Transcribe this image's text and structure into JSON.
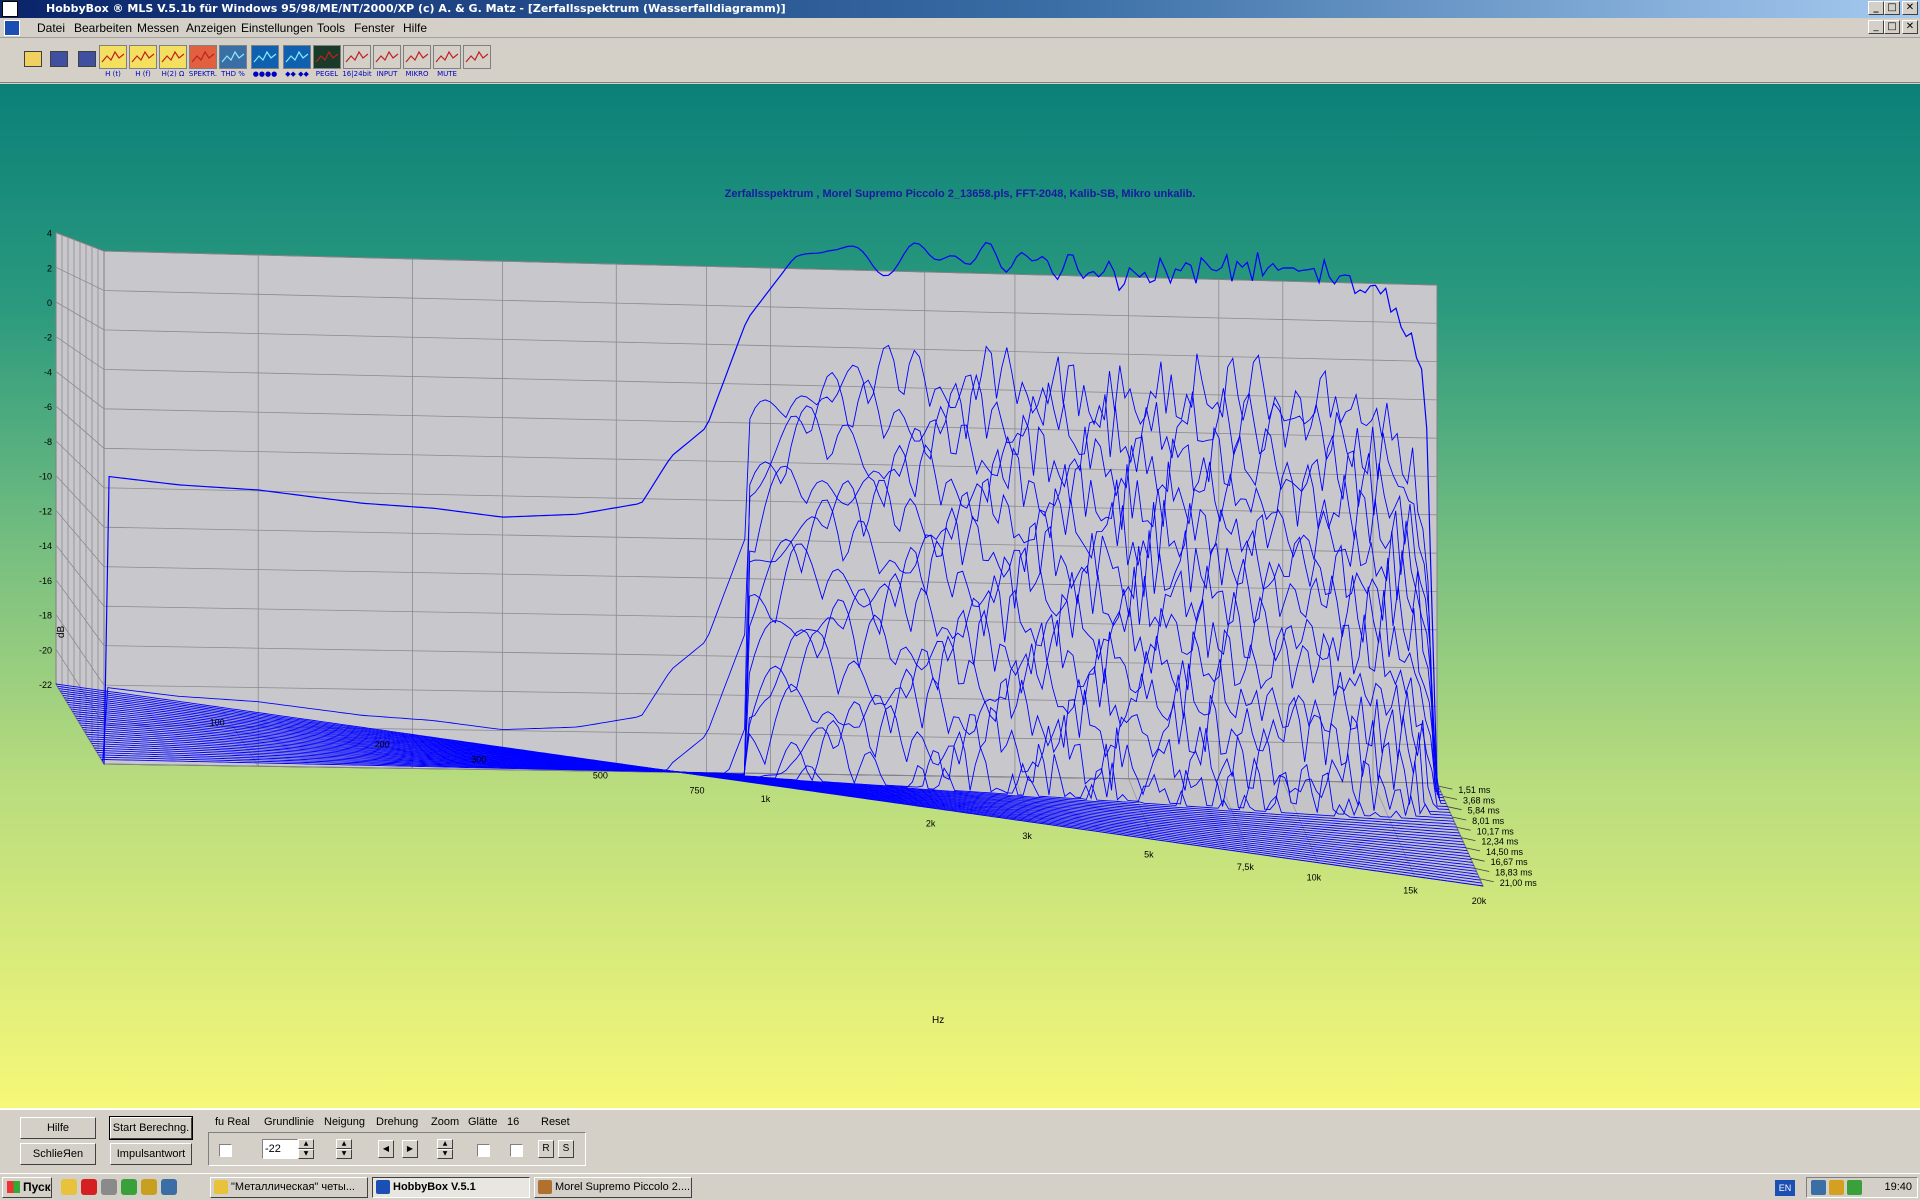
{
  "window": {
    "title": "HobbyBox ® MLS  V.5.1b   für Windows 95/98/ME/NT/2000/XP      (c)  A. & G. Matz - [Zerfallsspektrum  (Wasserfalldiagramm)]",
    "min": "_",
    "max": "□",
    "close": "✕"
  },
  "menu": [
    "Datei",
    "Bearbeiten",
    "Messen",
    "Anzeigen",
    "Einstellungen",
    "Tools",
    "Fenster",
    "Hilfe"
  ],
  "toolbar": [
    {
      "name": "open-icon",
      "label": ""
    },
    {
      "name": "save-icon",
      "label": ""
    },
    {
      "name": "print-icon",
      "label": ""
    },
    {
      "name": "impulse-response-icon",
      "label": "H (t)"
    },
    {
      "name": "frequency-response-icon",
      "label": "H (f)"
    },
    {
      "name": "impedance-icon",
      "label": "H(2) Ω"
    },
    {
      "name": "spectrum-icon",
      "label": "SPEKTR."
    },
    {
      "name": "thd-icon",
      "label": "THD %"
    },
    {
      "name": "meter-icon",
      "label": "●●●●"
    },
    {
      "name": "bargraph-icon",
      "label": "◆◆ ◆◆"
    },
    {
      "name": "level-icon",
      "label": "PEGEL"
    },
    {
      "name": "bit-icon",
      "label": "16|24bit"
    },
    {
      "name": "input-icon",
      "label": "INPUT"
    },
    {
      "name": "microphone-icon",
      "label": "MIKRO"
    },
    {
      "name": "mute-icon",
      "label": "MUTE"
    },
    {
      "name": "exit-icon",
      "label": ""
    }
  ],
  "chart_data": {
    "type": "waterfall",
    "title": "Zerfallsspektrum , Morel Supremo Piccolo 2_13658.pls, FFT-2048, Kalib-SB, Mikro unkalib.",
    "ylabel": "dB",
    "xlabel": "Hz",
    "y_ticks": [
      "4",
      "2",
      "0",
      "-2",
      "-4",
      "-6",
      "-8",
      "-10",
      "-12",
      "-14",
      "-16",
      "-18",
      "-20",
      "-22"
    ],
    "ylim": [
      -22,
      4
    ],
    "x_ticks": [
      "100",
      "200",
      "300",
      "500",
      "750",
      "1k",
      "2k",
      "3k",
      "5k",
      "7,5k",
      "10k",
      "15k",
      "20k"
    ],
    "xlim_hz": [
      50,
      20000
    ],
    "x_scale": "log",
    "time_ticks": [
      "1,51 ms",
      "3,68 ms",
      "5,84 ms",
      "8,01 ms",
      "10,17 ms",
      "12,34 ms",
      "14,50 ms",
      "16,67 ms",
      "18,83 ms",
      "21,00 ms"
    ],
    "slices": 36,
    "series_color": "#0000ff",
    "first_slice_db": [
      [
        50,
        -7.4
      ],
      [
        70,
        -7.8
      ],
      [
        100,
        -8.0
      ],
      [
        160,
        -8.6
      ],
      [
        220,
        -8.8
      ],
      [
        300,
        -9.2
      ],
      [
        420,
        -9.0
      ],
      [
        560,
        -8.4
      ],
      [
        640,
        -6.0
      ],
      [
        750,
        -4.5
      ],
      [
        900,
        1.0
      ],
      [
        1100,
        4.0
      ],
      [
        1300,
        4.6
      ],
      [
        1600,
        4.0
      ],
      [
        2000,
        4.4
      ],
      [
        3000,
        4.3
      ],
      [
        5000,
        3.4
      ],
      [
        7000,
        4.0
      ],
      [
        10000,
        4.0
      ],
      [
        12000,
        3.8
      ],
      [
        14000,
        3.2
      ],
      [
        16000,
        2.4
      ],
      [
        18000,
        0.0
      ],
      [
        19000,
        -2.0
      ],
      [
        20000,
        -22.0
      ]
    ]
  },
  "controls": {
    "help": "Hilfe",
    "start": "Start Berechng.",
    "close": "SchlieЯen",
    "impulse": "Impulsantwort",
    "labels": [
      "fu Real",
      "Grundlinie",
      "Neigung",
      "Drehung",
      "Zoom",
      "Glätte",
      "16",
      "Reset"
    ],
    "baseline_value": "-22",
    "r_label": "R",
    "s_label": "S"
  },
  "taskbar": {
    "start": "Пуск",
    "tasks": [
      "\"Металлическая\" четы...",
      "HobbyBox V.5.1",
      "Morel Supremo Piccolo 2...."
    ],
    "lang": "EN",
    "clock": "19:40"
  }
}
